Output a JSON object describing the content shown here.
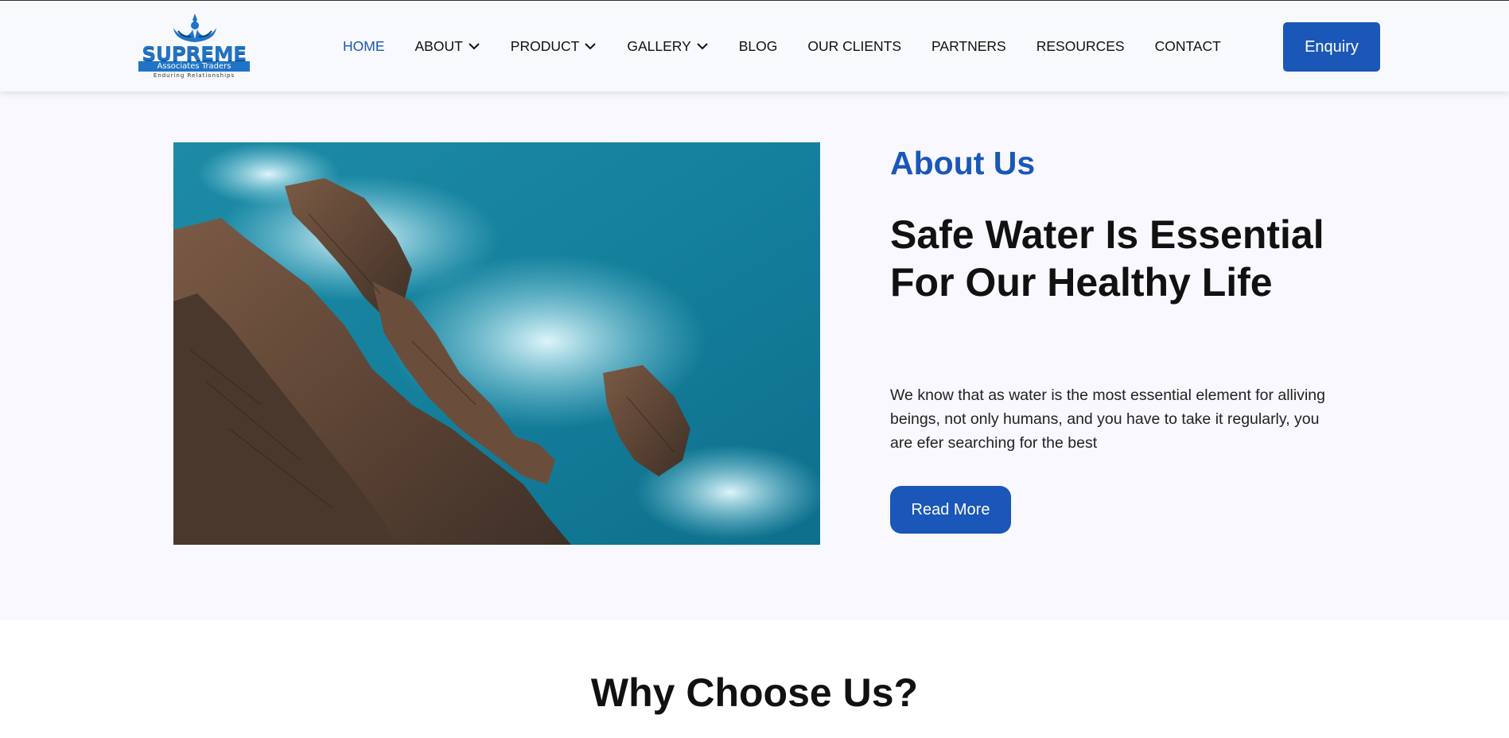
{
  "brand": {
    "name": "SUPREME",
    "subtitle": "Associates Traders",
    "tagline": "Enduring Relationships",
    "accent_color": "#1a57b8"
  },
  "nav": {
    "items": [
      {
        "label": "HOME",
        "active": true,
        "dropdown": false
      },
      {
        "label": "ABOUT",
        "active": false,
        "dropdown": true
      },
      {
        "label": "PRODUCT",
        "active": false,
        "dropdown": true
      },
      {
        "label": "GALLERY",
        "active": false,
        "dropdown": true
      },
      {
        "label": "BLOG",
        "active": false,
        "dropdown": false
      },
      {
        "label": "OUR CLIENTS",
        "active": false,
        "dropdown": false
      },
      {
        "label": "PARTNERS",
        "active": false,
        "dropdown": false
      },
      {
        "label": "RESOURCES",
        "active": false,
        "dropdown": false
      },
      {
        "label": "CONTACT",
        "active": false,
        "dropdown": false
      }
    ],
    "enquiry_label": "Enquiry"
  },
  "about": {
    "label": "About Us",
    "headline": "Safe Water Is Essential For Our Healthy Life",
    "paragraph": "We know that as water is the most essential element for alliving beings, not only humans, and you have to take it regularly, you are efer searching for the best",
    "read_more_label": "Read More",
    "image_icon": "coastline-aerial-photo"
  },
  "why": {
    "title": "Why Choose Us?"
  }
}
